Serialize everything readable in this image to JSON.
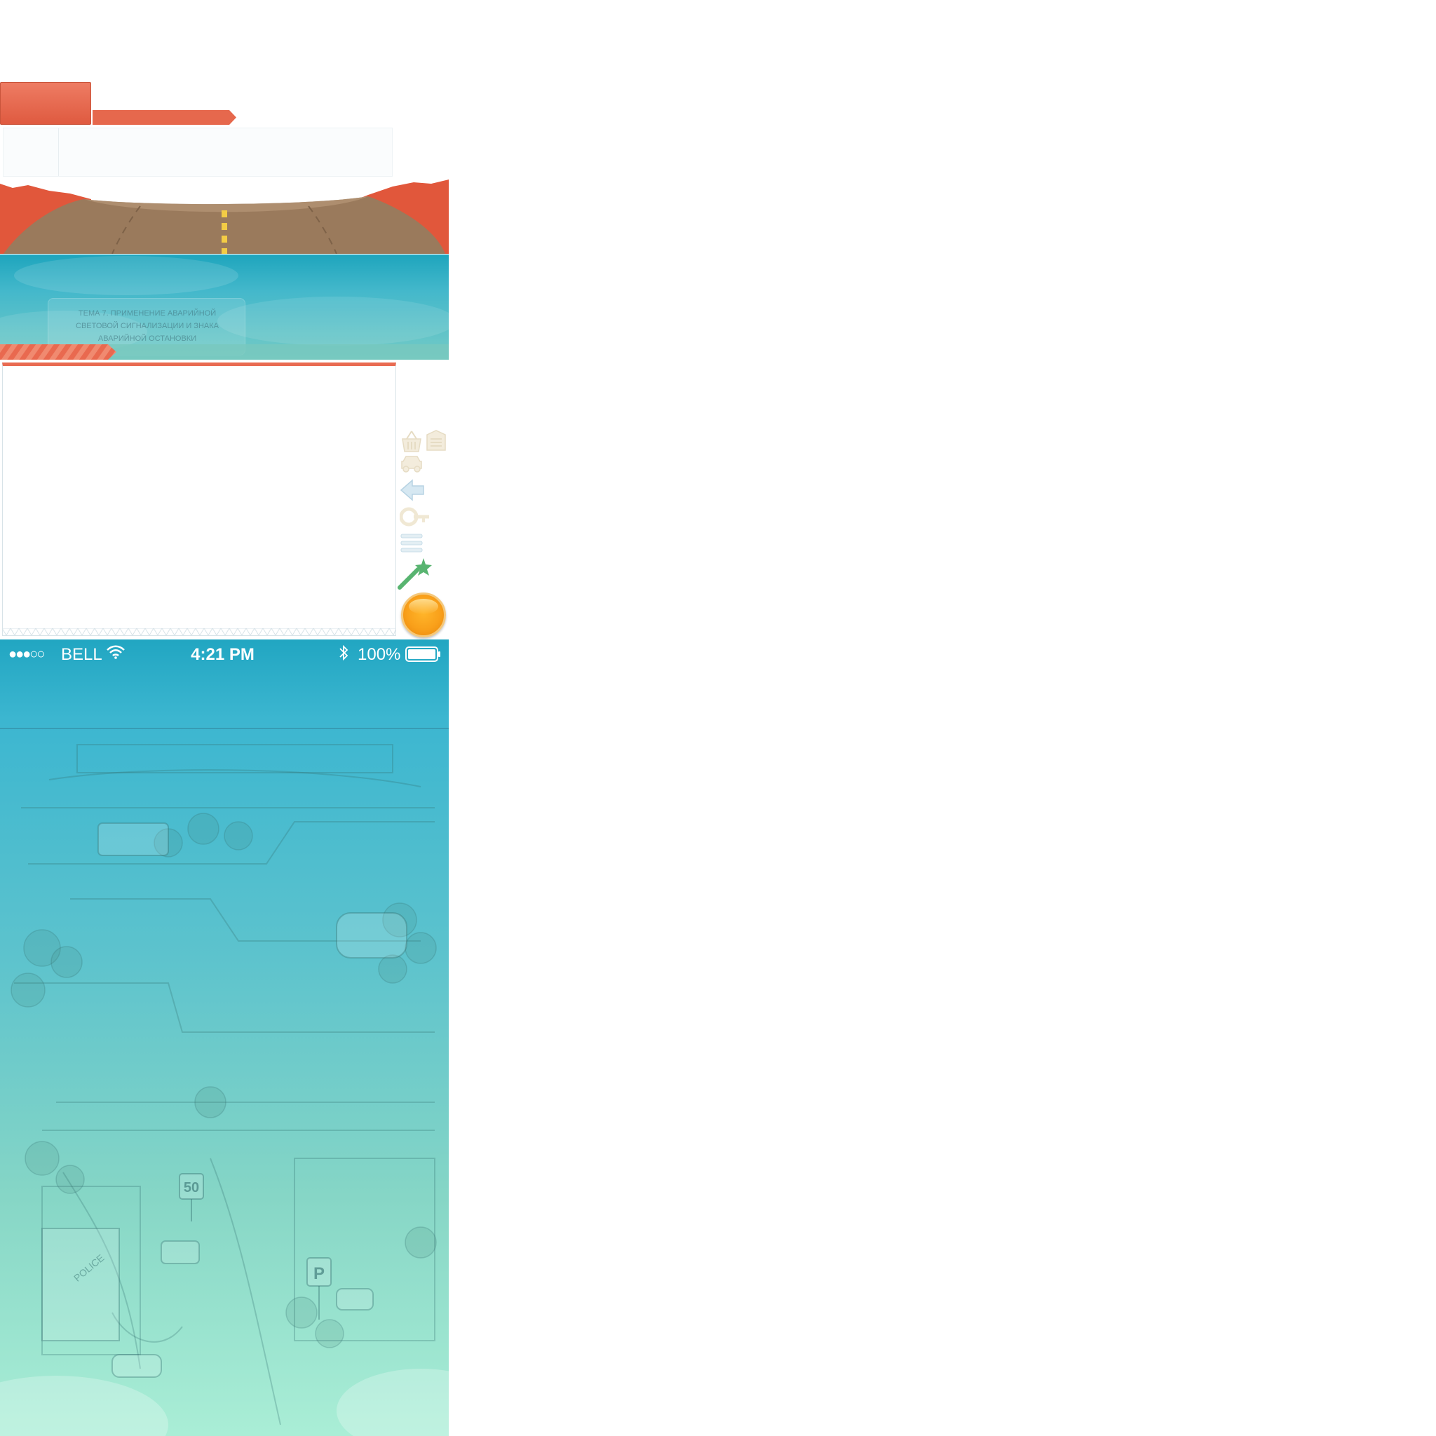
{
  "topic": {
    "text": "Тема 7. Применение аварийной световой сигнализации и знака аварийной остановки",
    "progress": 0.24
  },
  "status_bar": {
    "signal": "●●●○○",
    "carrier": "BELL",
    "time": "4:21 PM",
    "battery": "100%"
  },
  "map": {
    "speed_sign": "50",
    "parking_sign": "P",
    "police_label": "POLICE"
  },
  "colors": {
    "accent_red": "#e96b52",
    "teal": "#3cb6d0",
    "mint": "#aaeed6",
    "coin": "#f9a01a",
    "wand_green": "#58b470"
  },
  "icons": [
    "basket-icon",
    "document-icon",
    "car-icon",
    "back-arrow-icon",
    "key-icon",
    "menu-icon",
    "magic-wand-icon"
  ]
}
